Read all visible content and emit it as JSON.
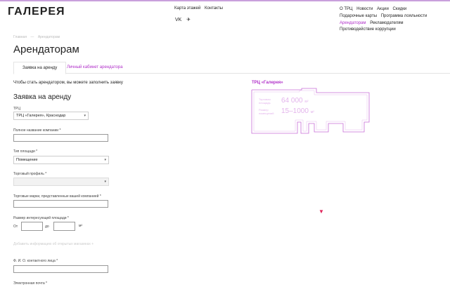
{
  "header": {
    "logo": "ГАЛЕРЕЯ",
    "center_nav": [
      "Карта этажей",
      "Контакты"
    ],
    "center_icons": [
      "vk-icon",
      "telegram-icon"
    ],
    "center_icon_glyphs": [
      "VK",
      "✈"
    ],
    "right_nav": {
      "row1": [
        "О ТРЦ",
        "Новости",
        "Акции",
        "Скидки"
      ],
      "row2": [
        "Подарочные карты",
        "Программа лояльности"
      ],
      "row3_active": "Арендаторам",
      "row3_other": "Рекламодателям",
      "row4": "Противодействие коррупции"
    }
  },
  "breadcrumbs": [
    "Главная",
    "—",
    "Арендаторам"
  ],
  "page_title": "Арендаторам",
  "tabs": [
    {
      "label": "Заявка на аренду",
      "active": true
    },
    {
      "label": "Личный кабинет арендатора",
      "active": false
    }
  ],
  "intro_text": "Чтобы стать арендатором, вы можете заполнить заявку",
  "form": {
    "title": "Заявка на аренду",
    "trc_label": "ТРЦ",
    "trc_value": "ТРЦ «Галерея», Краснодар",
    "company_label": "Полное название компании *",
    "area_type_label": "Тип площади *",
    "area_type_value": "Помещение",
    "profile_label": "Торговый профиль *",
    "brands_label": "Торговые марки, представленные вашей компанией *",
    "size_label": "Размер интересующей площади *",
    "from_label": "От",
    "to_label": "до",
    "unit_label": "м²",
    "add_info": "Добавить информацию об открытых магазинах +",
    "contact_label": "Ф. И. О. контактного лица *",
    "email_label": "Электронная почта *"
  },
  "map": {
    "title": "ТРЦ «Галерея»",
    "total_area_label": [
      "Торговая",
      "площадь"
    ],
    "total_area_value": "64 000",
    "total_area_unit": "м²",
    "premises_label": [
      "Размер",
      "помещений"
    ],
    "premises_value": "15–1000",
    "premises_unit": "м²"
  },
  "colors": {
    "accent": "#b02fc9",
    "marker": "#e0245a",
    "outline": "#c86fd8"
  }
}
